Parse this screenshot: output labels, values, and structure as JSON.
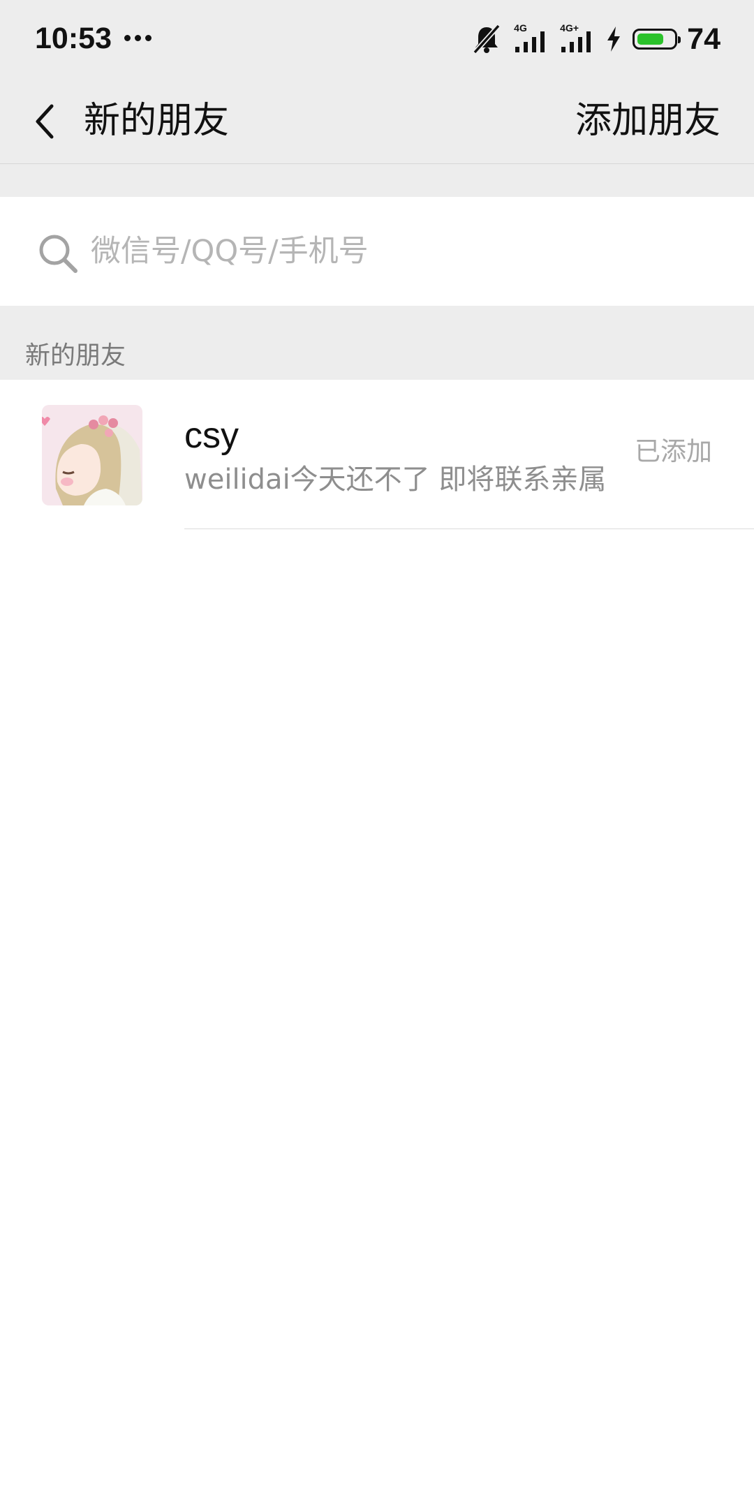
{
  "status_bar": {
    "time": "10:53",
    "network_1": "4G",
    "network_2": "4G+",
    "battery_percent": "74",
    "battery_level": 0.74,
    "battery_color": "#2bc22b"
  },
  "title_bar": {
    "back_icon": "chevron-left-icon",
    "title": "新的朋友",
    "action_label": "添加朋友"
  },
  "search": {
    "icon": "search-icon",
    "placeholder": "微信号/QQ号/手机号",
    "value": ""
  },
  "section": {
    "title": "新的朋友"
  },
  "friends": [
    {
      "name": "csy",
      "message": "weilidai今天还不了 即将联系亲属",
      "status": "已添加"
    }
  ],
  "colors": {
    "header_bg": "#ededed",
    "accent_green": "#2bc22b"
  }
}
